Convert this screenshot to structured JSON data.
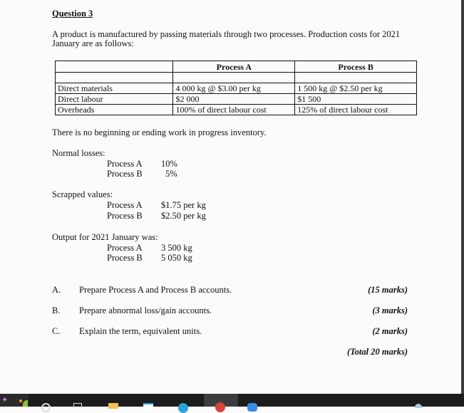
{
  "question": {
    "title": "Question 3",
    "intro": "A product is manufactured by passing materials through two processes. Production costs for 2021 January are as follows:"
  },
  "cost_table": {
    "headers": [
      "",
      "Process A",
      "Process B"
    ],
    "rows": [
      {
        "label": "",
        "a": "",
        "b": ""
      },
      {
        "label": "Direct materials",
        "a": "4 000 kg @ $3.00 per kg",
        "b": "1 500 kg @ $2.50 per kg"
      },
      {
        "label": "Direct labour",
        "a": "$2 000",
        "b": "$1 500"
      },
      {
        "label": "Overheads",
        "a": "100% of direct labour cost",
        "b": "125% of direct labour cost"
      }
    ]
  },
  "wip_note": "There is no beginning or ending work in progress inventory.",
  "normal_losses": {
    "heading": "Normal losses:",
    "items": [
      {
        "process": "Process A",
        "value": "10%"
      },
      {
        "process": "Process B",
        "value": "5%"
      }
    ]
  },
  "scrapped_values": {
    "heading": "Scrapped values:",
    "items": [
      {
        "process": "Process A",
        "value": "$1.75 per kg"
      },
      {
        "process": "Process B",
        "value": "$2.50 per kg"
      }
    ]
  },
  "output": {
    "heading": "Output for 2021 January was:",
    "items": [
      {
        "process": "Process A",
        "value": "3 500 kg"
      },
      {
        "process": "Process B",
        "value": "5 050 kg"
      }
    ]
  },
  "tasks": [
    {
      "letter": "A.",
      "text": "Prepare Process A and Process B accounts.",
      "marks": "(15 marks)"
    },
    {
      "letter": "B.",
      "text": "Prepare abnormal loss/gain accounts.",
      "marks": "(3 marks)"
    },
    {
      "letter": "C.",
      "text": "Explain the term, equivalent units.",
      "marks": "(2 marks)"
    }
  ],
  "total_marks": "(Total 20 marks)",
  "taskbar": {
    "icons": [
      "start-sparkle-icon",
      "widget-icon",
      "search-icon",
      "task-view-icon",
      "file-explorer-icon",
      "store-icon",
      "edge-icon",
      "chrome-icon",
      "zoom-icon",
      "system-tray-icon"
    ]
  }
}
